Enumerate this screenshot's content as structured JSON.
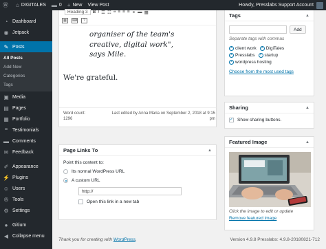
{
  "adminbar": {
    "site": "DIGITALES",
    "comments_count": "0",
    "new_label": "New",
    "view_label": "View Post",
    "howdy": "Howdy, Presslabs Support Account"
  },
  "sidebar": {
    "dashboard": "Dashboard",
    "jetpack": "Jetpack",
    "posts": "Posts",
    "posts_sub": [
      "All Posts",
      "Add New",
      "Categories",
      "Tags"
    ],
    "media": "Media",
    "pages": "Pages",
    "portfolio": "Portfolio",
    "testimonials": "Testimonials",
    "comments": "Comments",
    "feedback": "Feedback",
    "appearance": "Appearance",
    "plugins": "Plugins",
    "users": "Users",
    "tools": "Tools",
    "settings": "Settings",
    "gitium": "Gitium",
    "collapse": "Collapse menu"
  },
  "editor": {
    "format_select": "Heading 3",
    "quote_lines": [
      "organiser of the team's",
      "creative, digital work\",",
      "says Mile."
    ],
    "grateful": "We're grateful.",
    "word_count_label": "Word count:",
    "word_count": "1296",
    "last_edited": "Last edited by Anna Maria on September 2, 2018 at 9:15 pm"
  },
  "page_links": {
    "title": "Page Links To",
    "point_label": "Point this content to:",
    "option_normal": "Its normal WordPress URL",
    "option_custom": "A custom URL",
    "url_value": "http://",
    "new_tab_label": "Open this link in a new tab"
  },
  "tags": {
    "title": "Tags",
    "add_label": "Add",
    "hint": "Separate tags with commas",
    "items": [
      "client work",
      "DigiTales",
      "Presslabs",
      "startup",
      "wordpress hosting"
    ],
    "choose_link": "Choose from the most used tags"
  },
  "sharing": {
    "title": "Sharing",
    "show_label": "Show sharing buttons."
  },
  "featured": {
    "title": "Featured Image",
    "hint": "Click the image to edit or update",
    "remove_link": "Remove featured image"
  },
  "footer": {
    "thanks_prefix": "Thank you for creating with ",
    "wordpress_link": "WordPress",
    "thanks_suffix": ".",
    "version": "Version 4.9.8 Presslabs: 4.9.8-20180821-712"
  }
}
